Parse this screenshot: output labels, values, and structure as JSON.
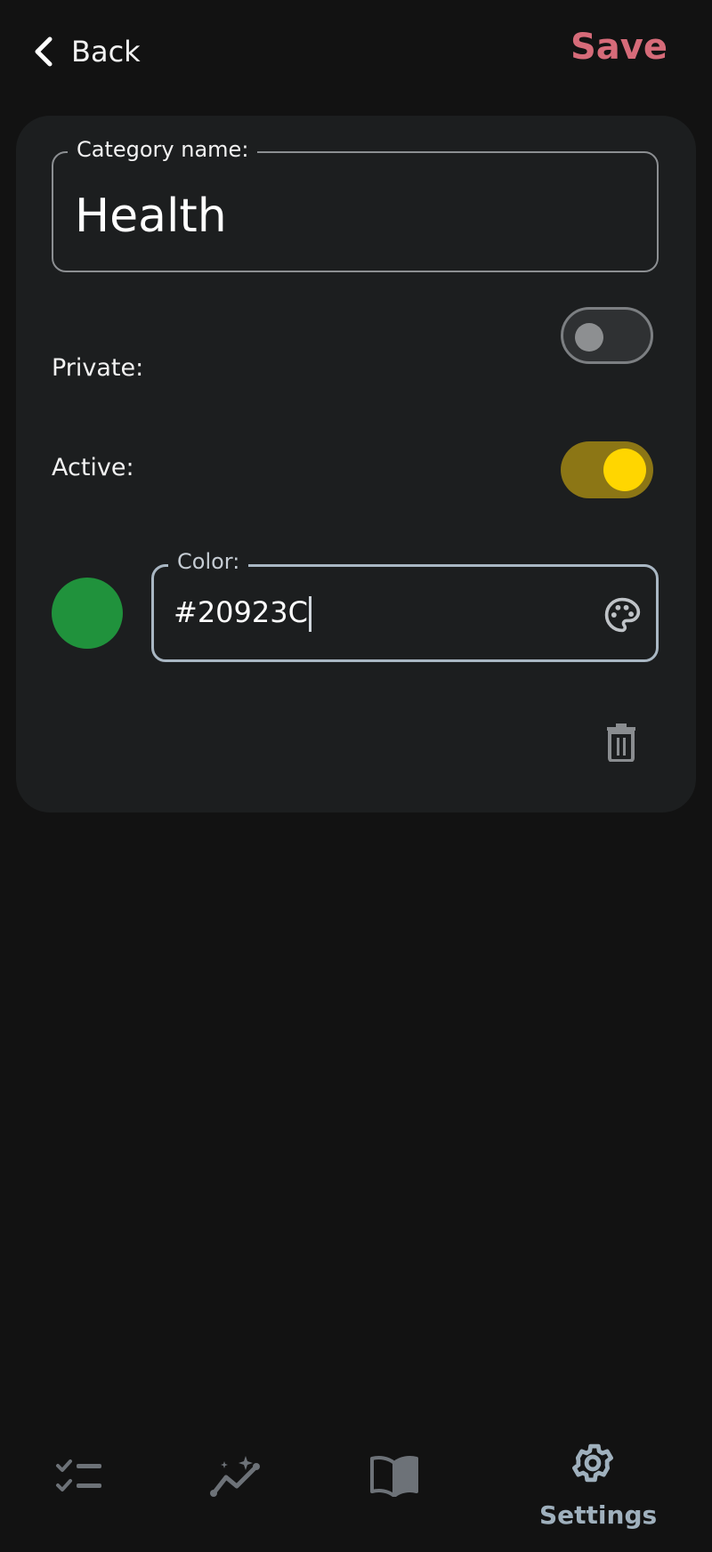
{
  "header": {
    "back_label": "Back",
    "save_label": "Save"
  },
  "form": {
    "category_label": "Category name:",
    "category_value": "Health",
    "private_label": "Private:",
    "private_on": false,
    "active_label": "Active:",
    "active_on": true,
    "color_label": "Color:",
    "color_value": "#20923C",
    "swatch_color": "#20923C"
  },
  "colors": {
    "accent_save": "#d66b79",
    "toggle_on_track": "#8c7615",
    "toggle_on_knob": "#ffd600",
    "active_nav": "#9fb0bd"
  },
  "icons": [
    "chevron-left-icon",
    "palette-icon",
    "trash-icon",
    "checklist-icon",
    "sparkle-chart-icon",
    "book-icon",
    "gear-icon"
  ],
  "bottom_nav": {
    "settings_label": "Settings"
  }
}
